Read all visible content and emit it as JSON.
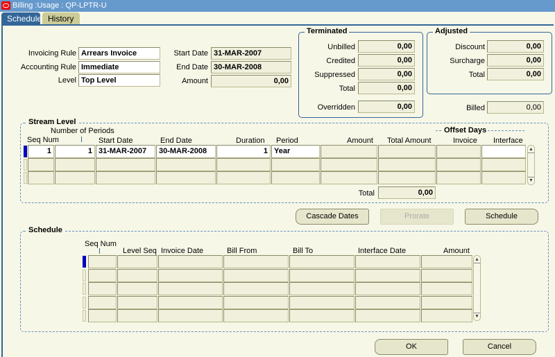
{
  "window": {
    "title": "Billing :Usage : QP-LPTR-U"
  },
  "tabs": [
    {
      "label": "Schedule",
      "active": true
    },
    {
      "label": "History",
      "active": false
    }
  ],
  "header": {
    "invoicing_rule_label": "Invoicing Rule",
    "invoicing_rule_value": "Arrears Invoice",
    "accounting_rule_label": "Accounting Rule",
    "accounting_rule_value": "Immediate",
    "level_label": "Level",
    "level_value": "Top Level",
    "start_date_label": "Start Date",
    "start_date_value": "31-MAR-2007",
    "end_date_label": "End Date",
    "end_date_value": "30-MAR-2008",
    "amount_label": "Amount",
    "amount_value": "0,00"
  },
  "terminated": {
    "title": "Terminated",
    "unbilled_label": "Unbilled",
    "unbilled_value": "0,00",
    "credited_label": "Credited",
    "credited_value": "0,00",
    "suppressed_label": "Suppressed",
    "suppressed_value": "0,00",
    "total_label": "Total",
    "total_value": "0,00",
    "overridden_label": "Overridden",
    "overridden_value": "0,00"
  },
  "adjusted": {
    "title": "Adjusted",
    "discount_label": "Discount",
    "discount_value": "0,00",
    "surcharge_label": "Surcharge",
    "surcharge_value": "0,00",
    "total_label": "Total",
    "total_value": "0,00"
  },
  "billed": {
    "label": "Billed",
    "value": "0,00"
  },
  "stream_level": {
    "title": "Stream Level",
    "columns": {
      "seq_num": "Seq Num",
      "num_periods": "Number of Periods",
      "start_date": "Start Date",
      "end_date": "End Date",
      "duration": "Duration",
      "period": "Period",
      "amount": "Amount",
      "total_amount": "Total Amount",
      "offset_days": "Offset Days",
      "invoice": "Invoice",
      "interface": "Interface"
    },
    "rows": [
      {
        "seq_num": "1",
        "num_periods": "1",
        "start_date": "31-MAR-2007",
        "end_date": "30-MAR-2008",
        "duration": "1",
        "period": "Year",
        "amount": "",
        "total_amount": "",
        "invoice": "",
        "interface": ""
      },
      {
        "seq_num": "",
        "num_periods": "",
        "start_date": "",
        "end_date": "",
        "duration": "",
        "period": "",
        "amount": "",
        "total_amount": "",
        "invoice": "",
        "interface": ""
      },
      {
        "seq_num": "",
        "num_periods": "",
        "start_date": "",
        "end_date": "",
        "duration": "",
        "period": "",
        "amount": "",
        "total_amount": "",
        "invoice": "",
        "interface": ""
      }
    ],
    "total_label": "Total",
    "total_value": "0,00"
  },
  "actions": {
    "cascade_dates": "Cascade Dates",
    "prorate": "Prorate",
    "schedule": "Schedule"
  },
  "schedule": {
    "title": "Schedule",
    "columns": {
      "seq_num": "Seq Num",
      "level_seq": "Level Seq",
      "invoice_date": "Invoice Date",
      "bill_from": "Bill From",
      "bill_to": "Bill To",
      "interface_date": "Interface Date",
      "amount": "Amount"
    },
    "row_count": 5
  },
  "footer": {
    "ok": "OK",
    "cancel": "Cancel"
  }
}
